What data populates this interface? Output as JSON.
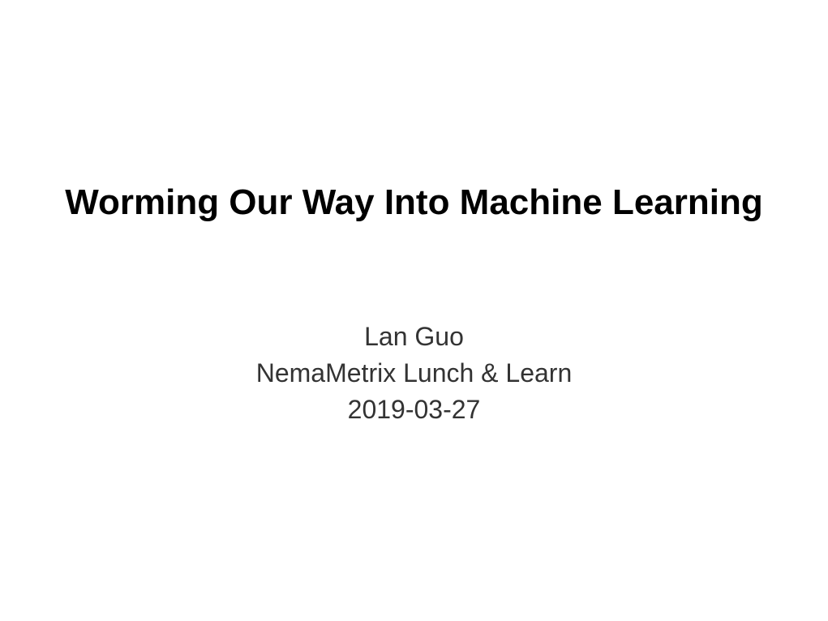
{
  "slide": {
    "title": "Worming Our Way Into Machine Learning",
    "subtitle_lines": [
      "Lan Guo",
      "NemaMetrix Lunch & Learn",
      "2019-03-27"
    ]
  },
  "colors": {
    "background": "#ffffff",
    "title_text": "#000000",
    "subtitle_text": "#333333"
  }
}
